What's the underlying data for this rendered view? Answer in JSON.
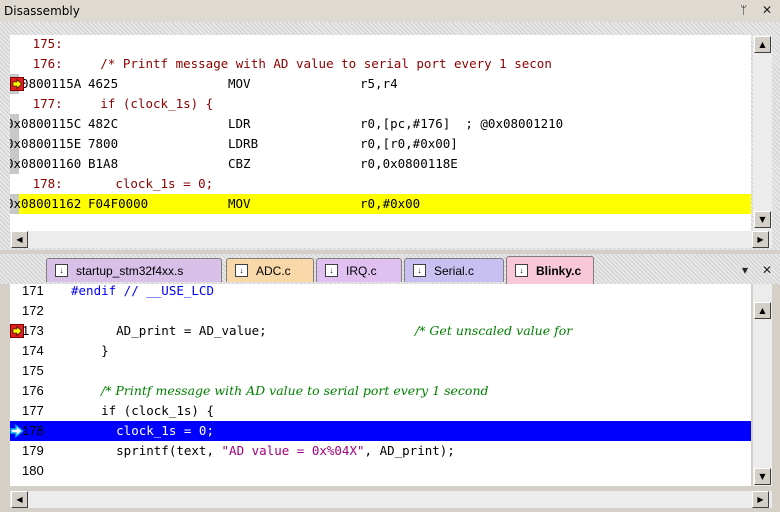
{
  "disassembly": {
    "title": "Disassembly",
    "pin_icon": "pin-icon",
    "close_icon": "close-icon",
    "lines": [
      {
        "type": "source",
        "text": "   175:"
      },
      {
        "type": "source",
        "text": "   176:     /* Printf message with AD value to serial port every 1 secon"
      },
      {
        "type": "asm",
        "addr": "0x0800115A",
        "code": "4625",
        "mnemonic": "MOV",
        "operands": "r5,r4",
        "marker": "current-instruction"
      },
      {
        "type": "source",
        "text": "   177:     if (clock_1s) {"
      },
      {
        "type": "asm",
        "addr": "0x0800115C",
        "code": "482C",
        "mnemonic": "LDR",
        "operands": "r0,[pc,#176]  ; @0x08001210"
      },
      {
        "type": "asm",
        "addr": "0x0800115E",
        "code": "7800",
        "mnemonic": "LDRB",
        "operands": "r0,[r0,#0x00]"
      },
      {
        "type": "asm",
        "addr": "0x08001160",
        "code": "B1A8",
        "mnemonic": "CBZ",
        "operands": "r0,0x0800118E"
      },
      {
        "type": "source",
        "text": "   178:       clock_1s = 0;"
      },
      {
        "type": "asm",
        "addr": "0x08001162",
        "code": "F04F0000",
        "mnemonic": "MOV",
        "operands": "r0,#0x00",
        "highlight": true
      }
    ]
  },
  "editor": {
    "tabs": [
      {
        "label": "startup_stm32f4xx.s",
        "color": "#d8c0e8",
        "active": false
      },
      {
        "label": "ADC.c",
        "color": "#f8d8a8",
        "active": false
      },
      {
        "label": "IRQ.c",
        "color": "#e0c0f0",
        "active": false
      },
      {
        "label": "Serial.c",
        "color": "#c8c0f0",
        "active": false
      },
      {
        "label": "Blinky.c",
        "color": "#f8c8d8",
        "active": true
      }
    ],
    "menu_icon": "dropdown-arrow-icon",
    "close_icon": "close-icon",
    "lines": [
      {
        "num": "171",
        "code": "#endif // __USE_LCD"
      },
      {
        "num": "172",
        "code": ""
      },
      {
        "num": "173",
        "code": "      AD_print = AD_value;",
        "comment": "/* Get unscaled value for",
        "marker": "current-instruction"
      },
      {
        "num": "174",
        "code": "    }"
      },
      {
        "num": "175",
        "code": ""
      },
      {
        "num": "176",
        "code": "",
        "comment": "/* Printf message with AD value to serial port every 1 second"
      },
      {
        "num": "177",
        "code": "    if (clock_1s) {"
      },
      {
        "num": "178",
        "code": "      clock_1s = 0;",
        "marker": "cursor",
        "selected": true
      },
      {
        "num": "179",
        "code": "      sprintf(text, ",
        "string": "\"AD value = 0x%04X\"",
        "tail": ", AD_print);"
      },
      {
        "num": "180",
        "code": ""
      }
    ]
  },
  "colors": {
    "highlight_yellow": "#ffff00",
    "selection_blue": "#0000ff",
    "source_line_red": "#8b0000",
    "comment_green": "#008000",
    "marker_red": "#e02020",
    "marker_cyan": "#00b0e0"
  }
}
